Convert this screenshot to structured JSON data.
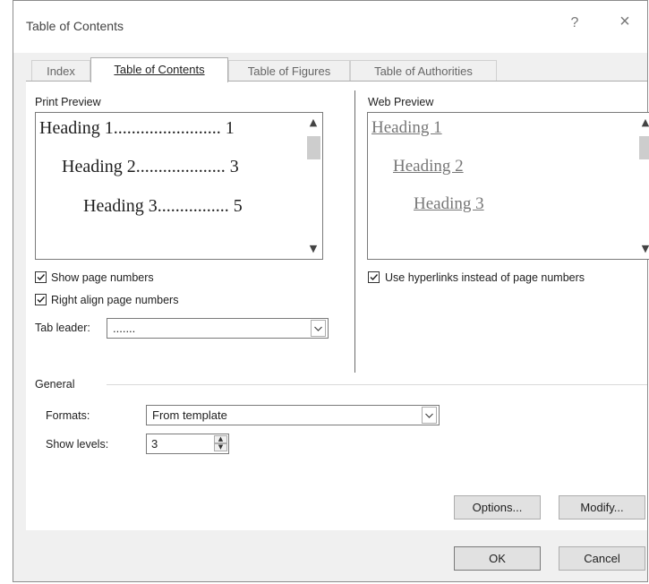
{
  "window": {
    "title": "Table of Contents",
    "help_label": "?",
    "close_label": "×"
  },
  "tabs": [
    {
      "label": "Index",
      "active": false
    },
    {
      "label": "Table of Contents",
      "active": true
    },
    {
      "label": "Table of Figures",
      "active": false
    },
    {
      "label": "Table of Authorities",
      "active": false
    }
  ],
  "print_preview": {
    "label": "Print Preview",
    "lines": [
      {
        "text": "Heading 1........................ 1"
      },
      {
        "text": "Heading 2.................... 3"
      },
      {
        "text": "Heading 3................ 5"
      }
    ]
  },
  "web_preview": {
    "label": "Web Preview",
    "links": [
      "Heading 1",
      "Heading 2",
      "Heading 3"
    ]
  },
  "options": {
    "show_page_numbers": {
      "label": "Show page numbers",
      "checked": true
    },
    "right_align": {
      "label": "Right align page numbers",
      "checked": true
    },
    "use_hyperlinks": {
      "label": "Use hyperlinks instead of page numbers",
      "checked": true
    },
    "tab_leader": {
      "label": "Tab leader:",
      "value": "......."
    }
  },
  "general": {
    "label": "General",
    "formats": {
      "label": "Formats:",
      "value": "From template"
    },
    "show_levels": {
      "label": "Show levels:",
      "value": "3"
    }
  },
  "buttons": {
    "options": "Options...",
    "modify": "Modify...",
    "ok": "OK",
    "cancel": "Cancel"
  },
  "colors": {
    "dialog_bg": "#f0f0f0",
    "panel_bg": "#ffffff",
    "web_link": "#777777"
  }
}
